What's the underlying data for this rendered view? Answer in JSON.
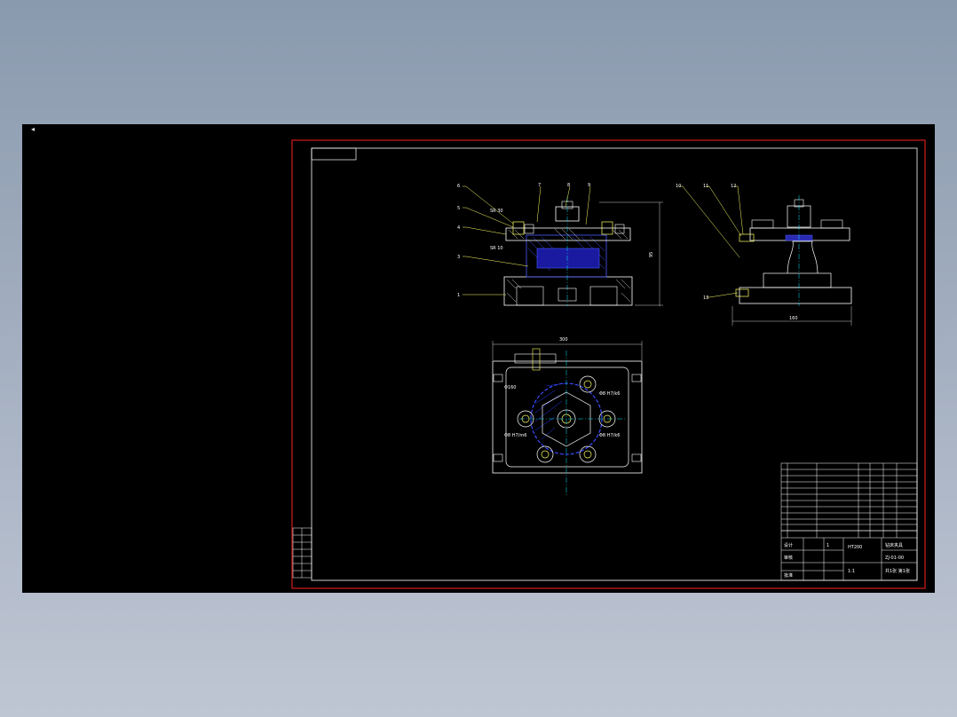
{
  "viewer": {
    "cursor_mark": "◂",
    "background": "#000000",
    "frame_color": "#ff2020",
    "line_color": "#ffffff"
  },
  "drawing": {
    "balloons_front": [
      "6",
      "5",
      "4",
      "3",
      "1",
      "7",
      "8",
      "9"
    ],
    "balloons_side": [
      "10",
      "11",
      "12",
      "13"
    ],
    "dim_top": "300",
    "dim_side": "160",
    "dim_right": "95",
    "label_sr30": "SR 30",
    "label_sr10": "SR 10",
    "label_d160": "Φ160",
    "label_top_right": "Φ8 H7/k6",
    "label_left": "Φ8 H7/m6",
    "label_bottom_right": "Φ8 H7/k6"
  },
  "title_block": {
    "drawing_title": "钻床夹具",
    "drawing_number": "ZJ-01-00",
    "scale": "1:1",
    "sheet": "共1张 第1张",
    "designer": "设计",
    "checker": "审核",
    "approver": "批准",
    "material": "HT200",
    "count": "1"
  }
}
